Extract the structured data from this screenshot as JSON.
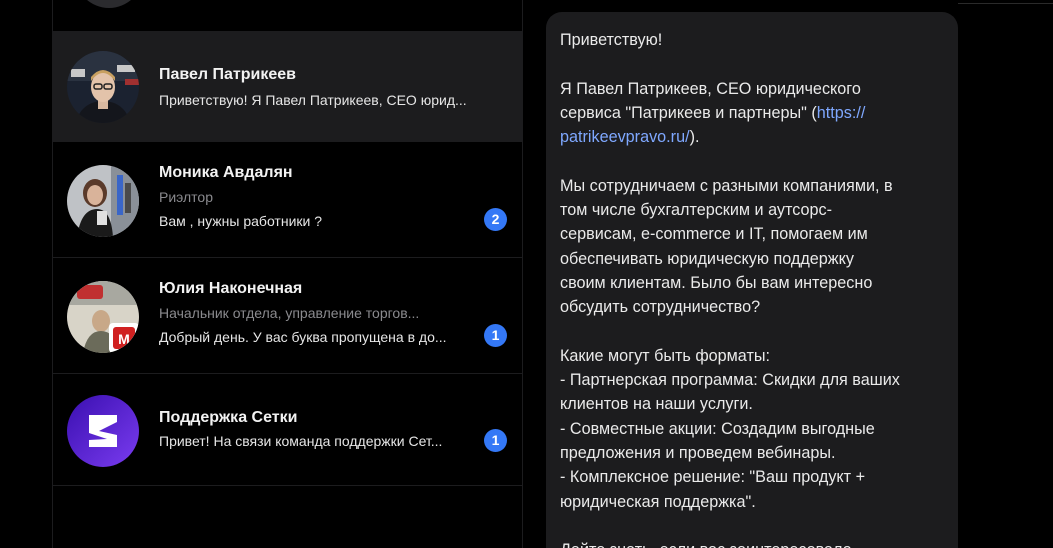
{
  "chats": [
    {
      "name": "Павел Патрикеев",
      "subtitle": "",
      "preview": "Приветствую! Я Павел Патрикеев, СЕО юрид...",
      "unread": "",
      "active": true,
      "avatar_icon": "user-photo-icon"
    },
    {
      "name": "Моника Авдалян",
      "subtitle": "Риэлтор",
      "preview": "Вам , нужны работники ?",
      "unread": "2",
      "active": false,
      "avatar_icon": "user-photo-icon"
    },
    {
      "name": "Юлия Наконечная",
      "subtitle": "Начальник отдела, управление торгов...",
      "preview": "Добрый день. У вас буква пропущена в до...",
      "unread": "1",
      "active": false,
      "avatar_icon": "user-photo-icon"
    },
    {
      "name": "Поддержка Сетки",
      "subtitle": "",
      "preview": "Привет! На связи команда поддержки Сет...",
      "unread": "1",
      "active": false,
      "avatar_icon": "setka-logo-icon"
    }
  ],
  "message": {
    "greeting": "Приветствую!",
    "p1_l1": "Я Павел Патрикеев, СЕО юридического",
    "p1_l2_pre": "сервиса \"Патрикеев и партнеры\" (",
    "p1_link_a": "https://",
    "p1_link_b": "patrikeevpravo.ru/",
    "p1_l3_post": ").",
    "p2_l1": "Мы сотрудничаем с разными компаниями, в",
    "p2_l2": "том числе бухгалтерским и аутсорс-",
    "p2_l3": "сервисам, e-commerce и IT, помогаем им",
    "p2_l4": "обеспечивать юридическую поддержку",
    "p2_l5": "своим клиентам. Было бы вам интересно",
    "p2_l6": "обсудить сотрудничество?",
    "p3_l1": "Какие могут быть форматы:",
    "p3_l2": "- Партнерская программа: Скидки для ваших",
    "p3_l3": "клиентов на наши услуги.",
    "p3_l4": "- Совместные акции: Создадим выгодные",
    "p3_l5": "предложения и проведем вебинары.",
    "p3_l6": "- Комплексное решение: \"Ваш продукт +",
    "p3_l7": "юридическая поддержка\".",
    "p4_l1": "Дайте знать, если вас заинтересовало"
  },
  "colors": {
    "background": "#000000",
    "panel": "#1c1c1e",
    "badge": "#3478f6",
    "link": "#7fa8ff"
  }
}
